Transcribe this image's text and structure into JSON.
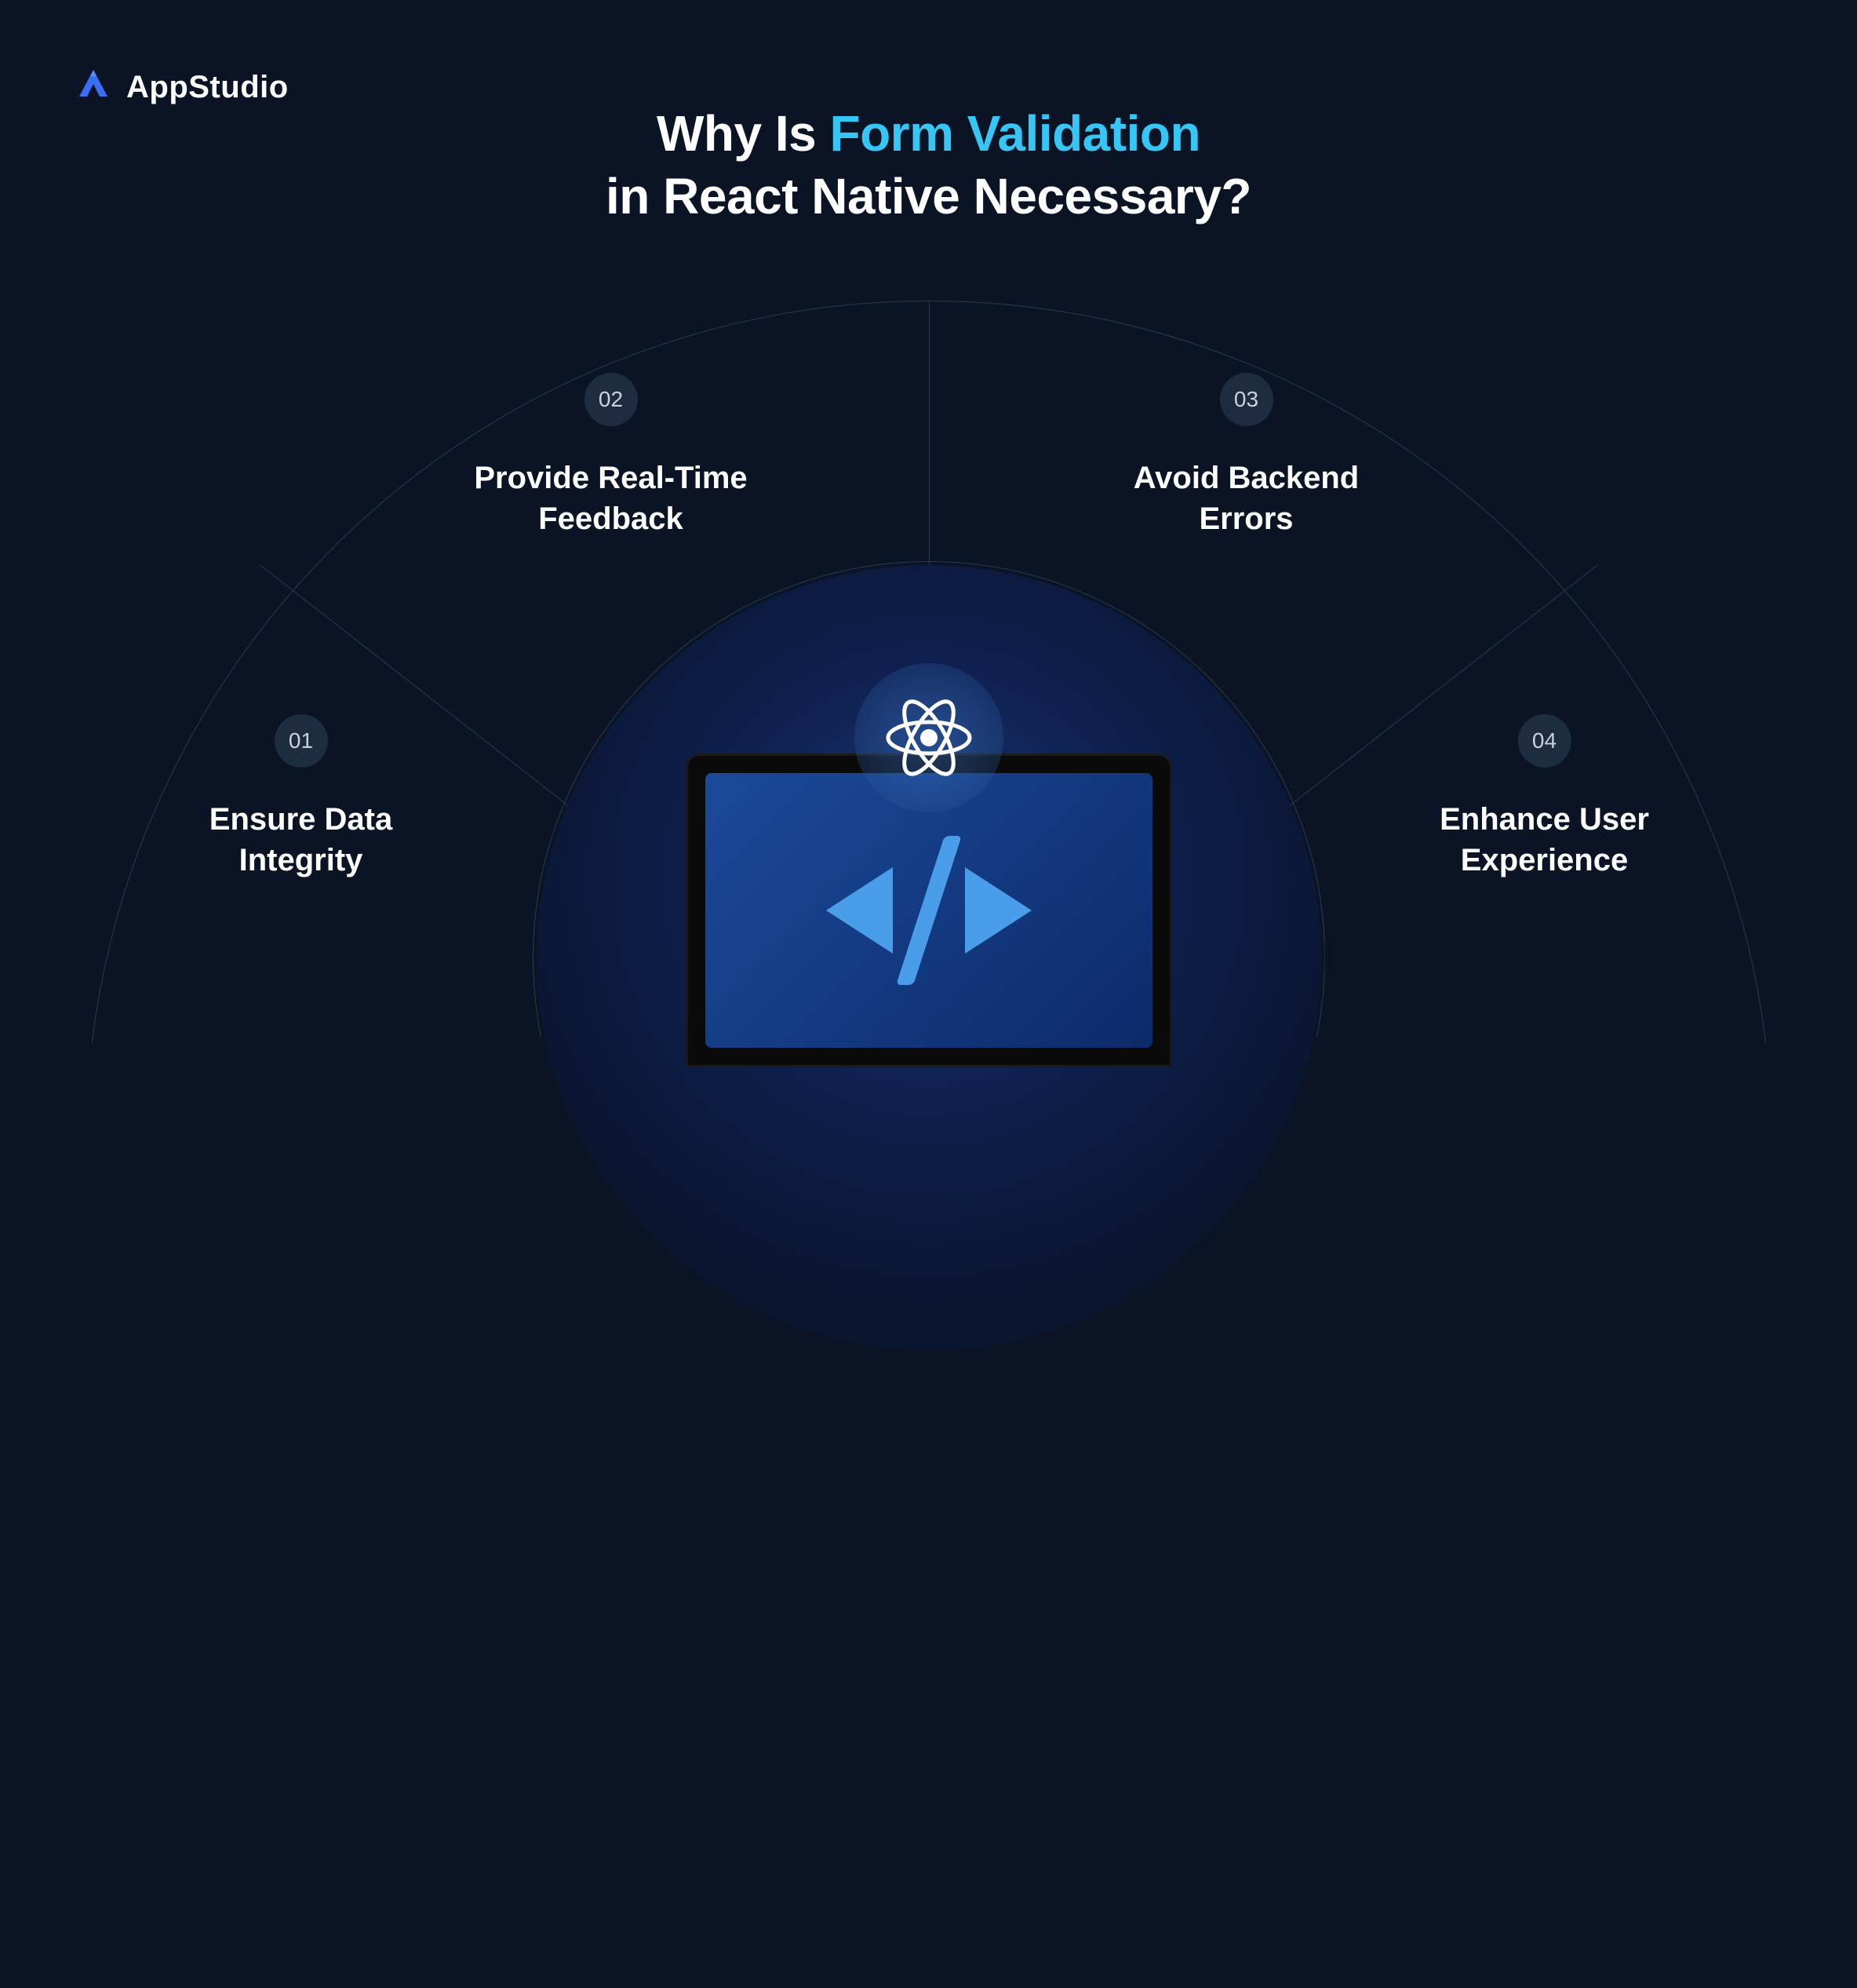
{
  "brand": {
    "name": "AppStudio"
  },
  "title": {
    "line1_prefix": "Why Is ",
    "line1_highlight": "Form Validation",
    "line2": "in React Native Necessary?"
  },
  "segments": [
    {
      "num": "01",
      "label_l1": "Ensure Data",
      "label_l2": "Integrity"
    },
    {
      "num": "02",
      "label_l1": "Provide Real-Time",
      "label_l2": "Feedback"
    },
    {
      "num": "03",
      "label_l1": "Avoid Backend",
      "label_l2": "Errors"
    },
    {
      "num": "04",
      "label_l1": "Enhance User",
      "label_l2": "Experience"
    }
  ],
  "icons": {
    "center": "react-atom-icon",
    "laptop": "code-brackets-icon"
  }
}
